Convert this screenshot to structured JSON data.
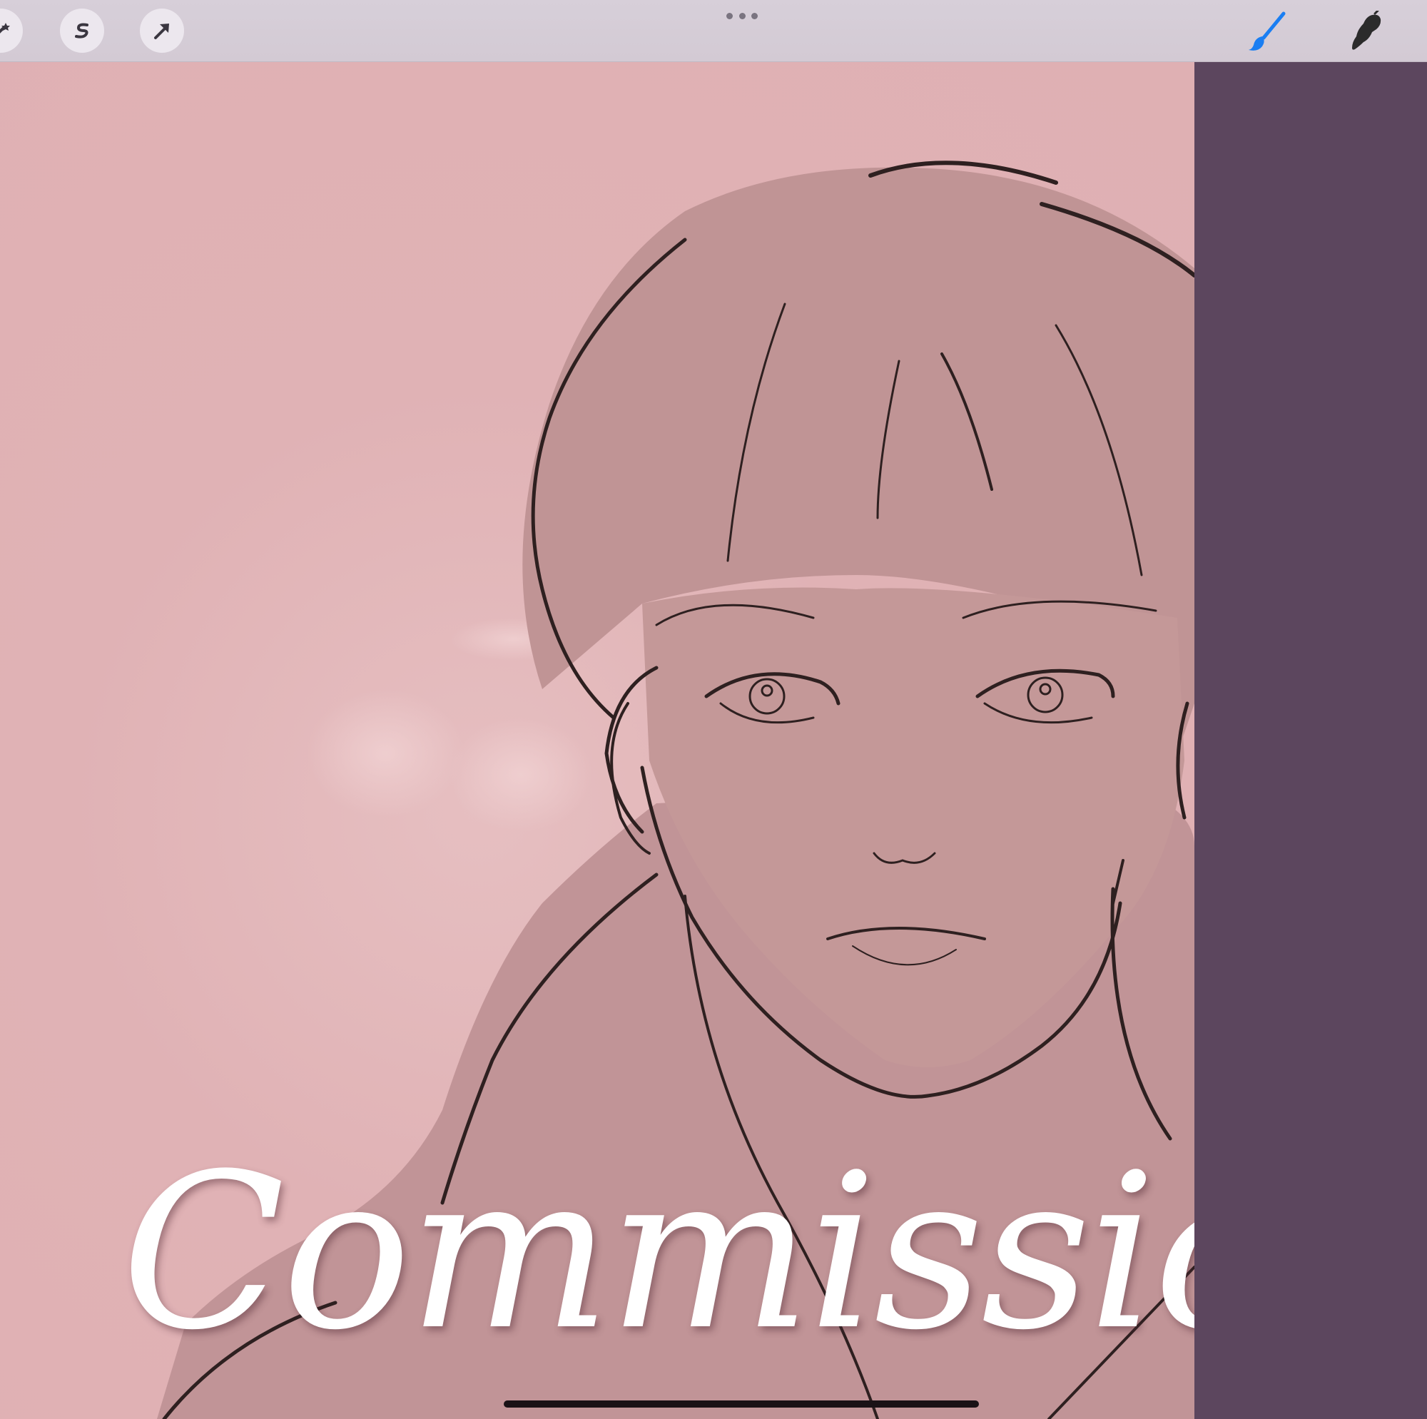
{
  "toolbar": {
    "left_tools": [
      {
        "name": "adjustments-icon"
      },
      {
        "name": "selection-icon"
      },
      {
        "name": "transform-icon"
      }
    ],
    "right_tools": [
      {
        "name": "brush-icon",
        "color": "#1a7ef2"
      },
      {
        "name": "smudge-icon",
        "color": "#2b2b2b"
      }
    ]
  },
  "artwork": {
    "caption": "Commission",
    "background_color": "#e0b2b5",
    "figure_color": "#c39797",
    "line_color": "#2e2020"
  },
  "side_panel": {
    "color": "#5c465e"
  }
}
